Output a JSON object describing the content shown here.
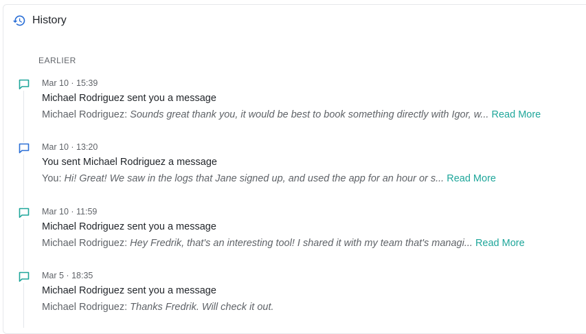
{
  "panel": {
    "title": "History",
    "icon": "history-icon",
    "accent_color": "#2b6fd6"
  },
  "section": {
    "label": "EARLIER"
  },
  "items": [
    {
      "icon": "message-icon",
      "icon_color": "#1ea69a",
      "date": "Mar 10",
      "time": "15:39",
      "heading": "Michael Rodriguez sent you a message",
      "sender": "Michael Rodriguez:",
      "preview": "Sounds great thank you, it would be best to book something directly with Igor, w...",
      "read_more": "Read More"
    },
    {
      "icon": "message-icon",
      "icon_color": "#2b6fd6",
      "date": "Mar 10",
      "time": "13:20",
      "heading": "You sent Michael Rodriguez a message",
      "sender": "You:",
      "preview": "Hi! Great! We saw in the logs that Jane signed up, and used the app for an hour or s...",
      "read_more": "Read More"
    },
    {
      "icon": "message-icon",
      "icon_color": "#1ea69a",
      "date": "Mar 10",
      "time": "11:59",
      "heading": "Michael Rodriguez sent you a message",
      "sender": "Michael Rodriguez:",
      "preview": "Hey Fredrik, that's an interesting tool! I shared it with my team that's managi...",
      "read_more": "Read More"
    },
    {
      "icon": "message-icon",
      "icon_color": "#1ea69a",
      "date": "Mar 5",
      "time": "18:35",
      "heading": "Michael Rodriguez sent you a message",
      "sender": "Michael Rodriguez:",
      "preview": "Thanks Fredrik.  Will check it out.",
      "read_more": ""
    }
  ],
  "colors": {
    "link": "#1ea69a",
    "text_primary": "#1f2328",
    "text_secondary": "#5f6368"
  }
}
